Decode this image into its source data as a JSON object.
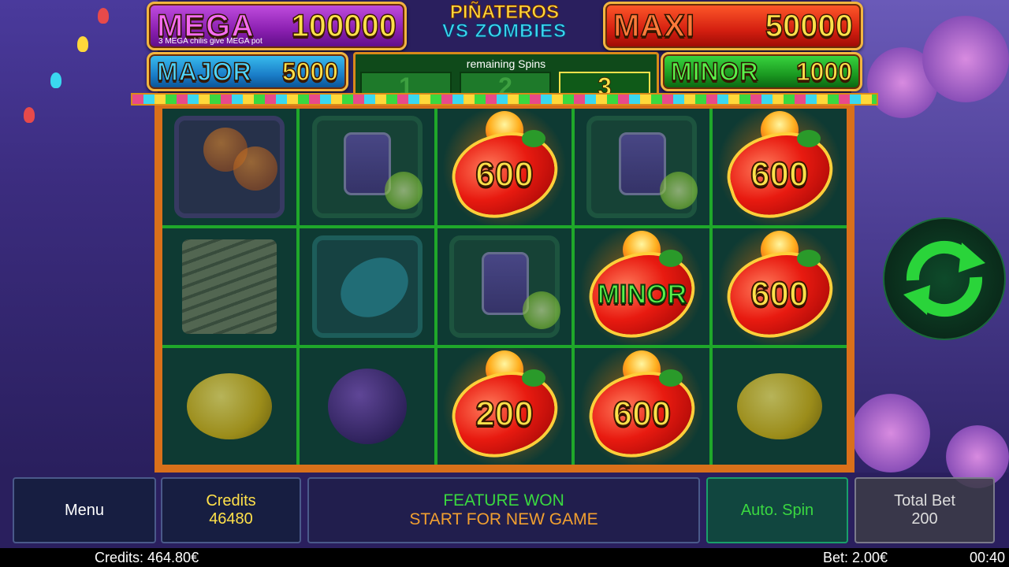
{
  "game": {
    "logo_line1": "PIÑATEROS",
    "logo_line2": "VS ZOMBIES"
  },
  "jackpots": {
    "mega": {
      "name": "MEGA",
      "value": "100000",
      "note": "3 MEGA chilis give MEGA pot"
    },
    "maxi": {
      "name": "MAXI",
      "value": "50000"
    },
    "major": {
      "name": "MAJOR",
      "value": "5000"
    },
    "minor": {
      "name": "MINOR",
      "value": "1000"
    }
  },
  "spins": {
    "title": "remaining Spins",
    "boxes": [
      "1",
      "2",
      "3"
    ],
    "active_index": 2
  },
  "reels": [
    [
      "pumpkin-maracas-icon",
      "potion-icon",
      "chili-600",
      "potion-icon",
      "chili-600"
    ],
    [
      "mummy-seven-icon",
      "guitar-icon",
      "potion-icon",
      "chili-minor",
      "chili-600"
    ],
    [
      "lemon-icon",
      "plum-icon",
      "chili-200",
      "chili-600",
      "lemon-icon"
    ]
  ],
  "chili_labels": {
    "r0c2": "600",
    "r0c4": "600",
    "r1c3": "MINOR",
    "r1c4": "600",
    "r2c2": "200",
    "r2c3": "600"
  },
  "buttons": {
    "menu": "Menu",
    "auto_spin": "Auto. Spin"
  },
  "credits_panel": {
    "label": "Credits",
    "value": "46480"
  },
  "message": {
    "line1": "FEATURE WON",
    "line2": "START FOR NEW GAME"
  },
  "total_bet": {
    "label": "Total Bet",
    "value": "200"
  },
  "status": {
    "credits": "Credits: 464.80€",
    "bet": "Bet: 2.00€",
    "time": "00:40"
  },
  "colors": {
    "accent_green": "#3ad840",
    "accent_yellow": "#ffe14a",
    "frame_orange": "#d9701a"
  }
}
